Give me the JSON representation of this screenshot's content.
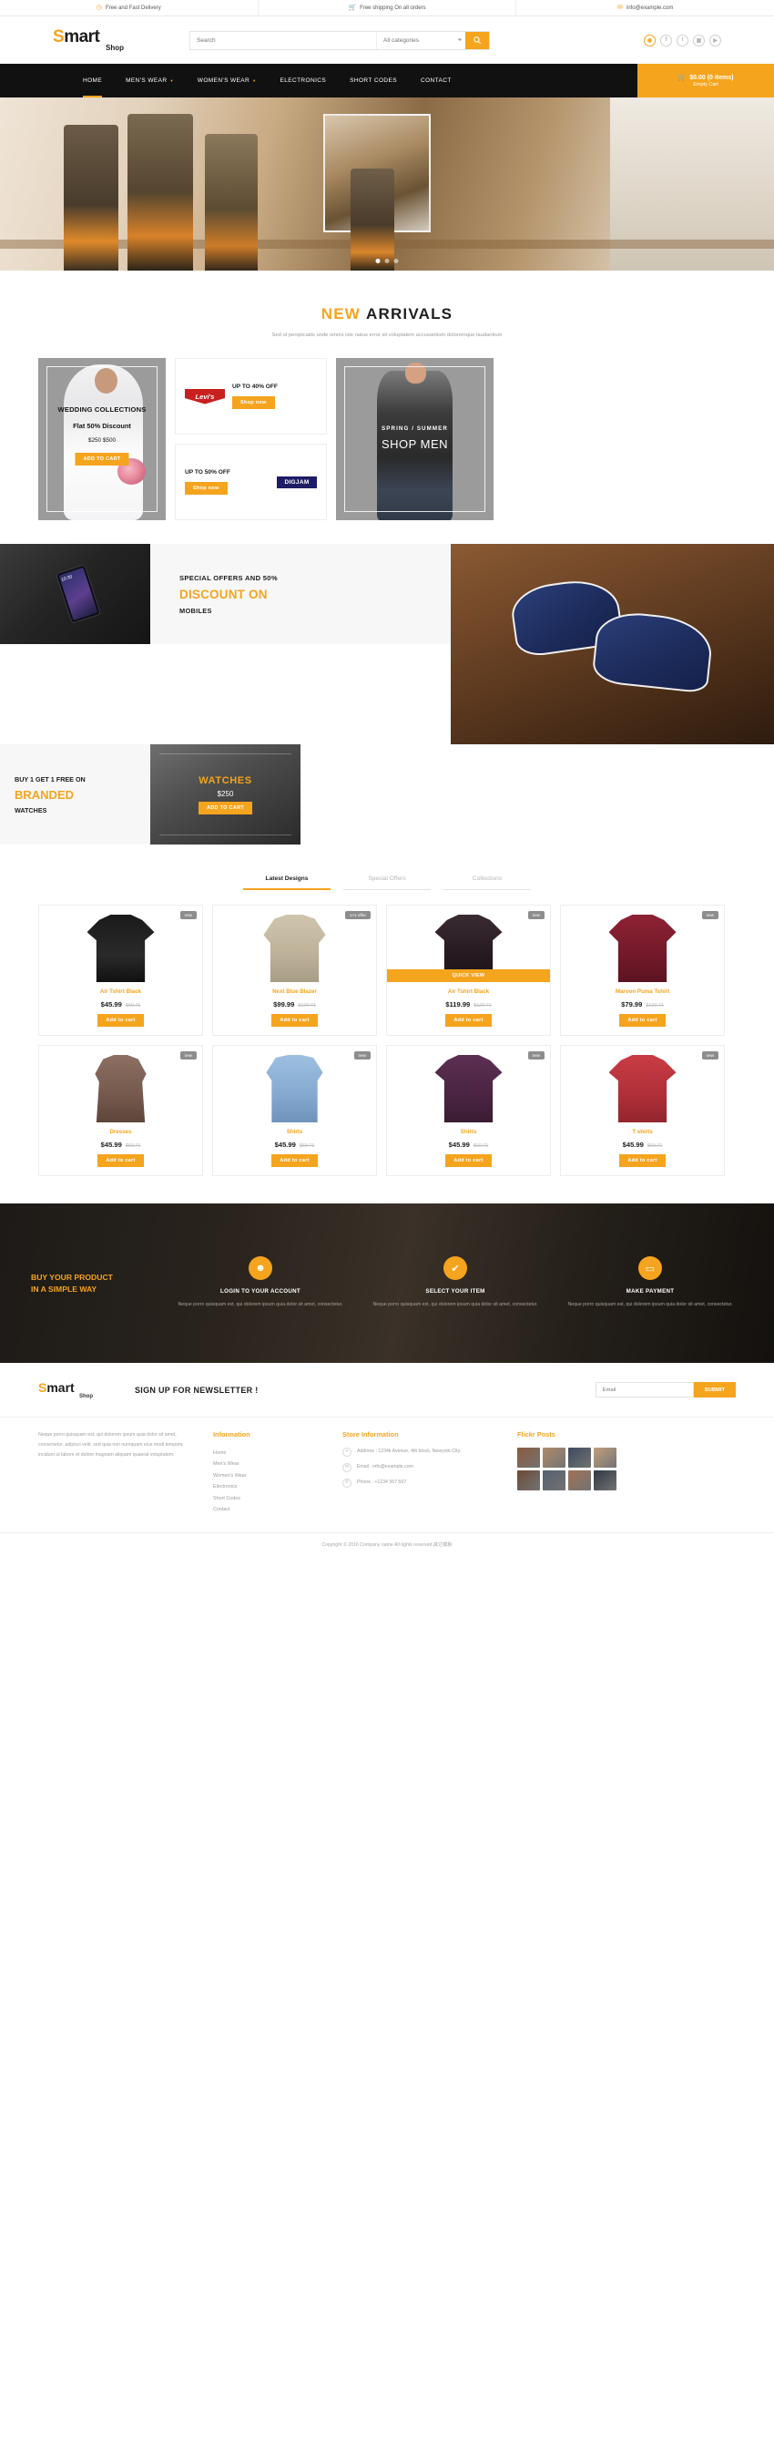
{
  "topbar": [
    {
      "icon": "clock-icon",
      "text": "Free and Fast Delivery"
    },
    {
      "icon": "cart-icon",
      "text": "Free shipping On all orders"
    },
    {
      "icon": "mail-icon",
      "text": "info@example.com"
    }
  ],
  "header": {
    "logo_main": "mart",
    "logo_s": "S",
    "logo_sub": "Shop",
    "search_placeholder": "Search",
    "search_category": "All categories",
    "search_icon": "search-icon",
    "socials": [
      "user-icon",
      "facebook-icon",
      "twitter-icon",
      "instagram-icon",
      "youtube-icon"
    ]
  },
  "nav": {
    "items": [
      {
        "label": "HOME",
        "active": true,
        "caret": false
      },
      {
        "label": "MEN'S WEAR",
        "active": false,
        "caret": true
      },
      {
        "label": "WOMEN'S WEAR",
        "active": false,
        "caret": true
      },
      {
        "label": "ELECTRONICS",
        "active": false,
        "caret": false
      },
      {
        "label": "SHORT CODES",
        "active": false,
        "caret": false
      },
      {
        "label": "CONTACT",
        "active": false,
        "caret": false
      }
    ],
    "cart_total": "$0.00 (0 items)",
    "cart_sub": "Empty Cart"
  },
  "arrivals": {
    "title_hl": "NEW",
    "title_rest": "ARRIVALS",
    "subtitle": "Sed ut perspiciatis unde omnis iste natus error sit voluptatem accusantium doloremque laudantium"
  },
  "promos": {
    "wedding": {
      "title": "WEDDING COLLECTIONS",
      "discount": "Flat 50% Discount",
      "price": "$250 $500",
      "button": "ADD TO CART"
    },
    "levis": {
      "brand": "Levi's",
      "offer": "UP TO 40% OFF",
      "button": "Shop now"
    },
    "digjam": {
      "brand": "DIGJAM",
      "offer": "UP TO 50% OFF",
      "button": "Shop now"
    },
    "shopmen": {
      "sub": "SPRING / SUMMER",
      "title": "SHOP MEN"
    }
  },
  "band": {
    "mobiles": {
      "line1": "SPECIAL OFFERS AND 50%",
      "line2": "DISCOUNT ON",
      "line3": "MOBILES"
    },
    "branded": {
      "line1": "BUY 1 GET 1 FREE ON",
      "line2": "BRANDED",
      "line3": "WATCHES"
    },
    "watches": {
      "title": "WATCHES",
      "price": "$250",
      "button": "ADD TO CART"
    },
    "phone_time": "10:30"
  },
  "product_tabs": [
    {
      "label": "Latest Designs",
      "active": true
    },
    {
      "label": "Special Offers",
      "active": false
    },
    {
      "label": "Collections",
      "active": false
    }
  ],
  "products": [
    {
      "name": "Air Tshirt Black",
      "price": "$45.99",
      "old": "$69.71",
      "badge": "new",
      "button": "Add to cart",
      "quick": null,
      "art": "g-tee-black"
    },
    {
      "name": "Next Blue Blazer",
      "price": "$99.99",
      "old": "$109.71",
      "badge": "1×1 offer",
      "button": "Add to cart",
      "quick": null,
      "art": "g-blazer"
    },
    {
      "name": "Air Tshirt Black",
      "price": "$119.99",
      "old": "$120.71",
      "badge": "new",
      "button": "Add to cart",
      "quick": "QUICK VIEW",
      "art": "g-tee-dark"
    },
    {
      "name": "Maroon Puma Tshirt",
      "price": "$79.99",
      "old": "$120.71",
      "badge": "new",
      "button": "Add to cart",
      "quick": null,
      "art": "g-maroon"
    },
    {
      "name": "Dresses",
      "price": "$45.99",
      "old": "$69.71",
      "badge": "new",
      "button": "Add to cart",
      "quick": null,
      "art": "g-dress"
    },
    {
      "name": "Shirts",
      "price": "$45.99",
      "old": "$69.71",
      "badge": "new",
      "button": "Add to cart",
      "quick": null,
      "art": "g-vest"
    },
    {
      "name": "Shirts",
      "price": "$45.99",
      "old": "$69.71",
      "badge": "new",
      "button": "Add to cart",
      "quick": null,
      "art": "g-shirt"
    },
    {
      "name": "T shirts",
      "price": "$45.99",
      "old": "$69.71",
      "badge": "new",
      "button": "Add to cart",
      "quick": null,
      "art": "g-tshirt"
    }
  ],
  "services": {
    "head1": "BUY YOUR PRODUCT",
    "head2": "IN A SIMPLE WAY",
    "items": [
      {
        "icon": "user-icon",
        "title": "LOGIN TO YOUR ACCOUNT",
        "desc": "Neque porro quisquam est, qui dolorem ipsum quia dolor sit amet, consectetur."
      },
      {
        "icon": "check-icon",
        "title": "SELECT YOUR ITEM",
        "desc": "Neque porro quisquam est, qui dolorem ipsum quia dolor sit amet, consectetur."
      },
      {
        "icon": "card-icon",
        "title": "MAKE PAYMENT",
        "desc": "Neque porro quisquam est, qui dolorem ipsum quia dolor sit amet, consectetur."
      }
    ]
  },
  "newsletter": {
    "logo_s": "S",
    "logo_main": "mart",
    "logo_sub": "Shop",
    "title": "SIGN UP FOR NEWSLETTER !",
    "placeholder": "Email",
    "button": "SUBMIT"
  },
  "footer": {
    "about": "Neque porro quisquam est, qui dolorem ipsum quia dolor sit amet, consectetur, adipisci velit, sed quia non numquam eius modi tempora incidunt ut labore et dolore magnam aliquam quaerat voluptatem.",
    "information": {
      "head": "Information",
      "links": [
        "Home",
        "Men's Wear",
        "Women's Wear",
        "Electronics",
        "Short Codes",
        "Contact"
      ]
    },
    "store": {
      "head": "Store Information",
      "rows": [
        {
          "icon": "pin-icon",
          "text": "Address : 1234k Avenue, 4th block, Newyork City."
        },
        {
          "icon": "mail-icon",
          "text": "Email : info@example.com"
        },
        {
          "icon": "phone-icon",
          "text": "Phone : +1234 567 567"
        }
      ]
    },
    "flickr": {
      "head": "Flickr Posts"
    },
    "copyright": "Copyright © 2016 Company name All rights reserved.其它模板"
  },
  "colors": {
    "accent": "#f5a41d",
    "dark": "#111111",
    "muted": "#9b9b9b"
  }
}
